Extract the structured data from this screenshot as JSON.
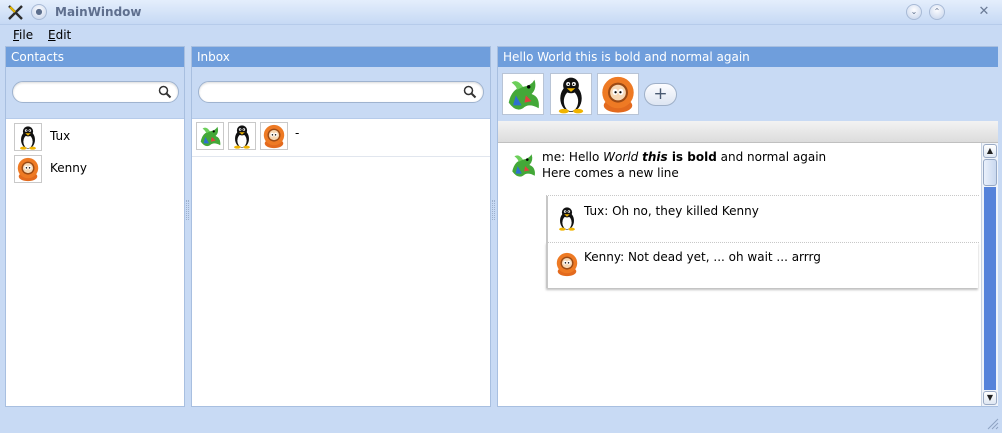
{
  "window": {
    "title": "MainWindow"
  },
  "menu": {
    "file_mnemonic": "F",
    "file_rest": "ile",
    "edit_mnemonic": "E",
    "edit_rest": "dit"
  },
  "contacts": {
    "header": "Contacts",
    "search_value": "",
    "items": [
      {
        "name": "Tux",
        "avatar": "tux-avatar-icon"
      },
      {
        "name": "Kenny",
        "avatar": "kenny-avatar-icon"
      }
    ]
  },
  "inbox": {
    "header": "Inbox",
    "search_value": "",
    "items": [
      {
        "avatars": [
          "dragon-avatar-icon",
          "tux-avatar-icon",
          "kenny-avatar-icon"
        ],
        "preview": "-"
      }
    ]
  },
  "conversation": {
    "header": "Hello World this is bold and normal again",
    "participants": [
      "dragon-avatar-icon",
      "tux-avatar-icon",
      "kenny-avatar-icon"
    ],
    "add_label": "+",
    "message": {
      "prefix": "me: Hello ",
      "italic": "World",
      "bold_italic": "this",
      "bold": " is bold",
      "suffix": " and normal again",
      "line2": "Here comes a new line"
    },
    "replies": [
      {
        "text": "Tux: Oh no, they killed Kenny",
        "avatar": "tux-avatar-icon"
      },
      {
        "text": "Kenny: Not dead yet, ... oh wait ... arrrg",
        "avatar": "kenny-avatar-icon"
      }
    ]
  },
  "colors": {
    "header_bg": "#6f9edc",
    "window_bg": "#c8daf4",
    "scroll_fill": "#3b6fd3"
  }
}
